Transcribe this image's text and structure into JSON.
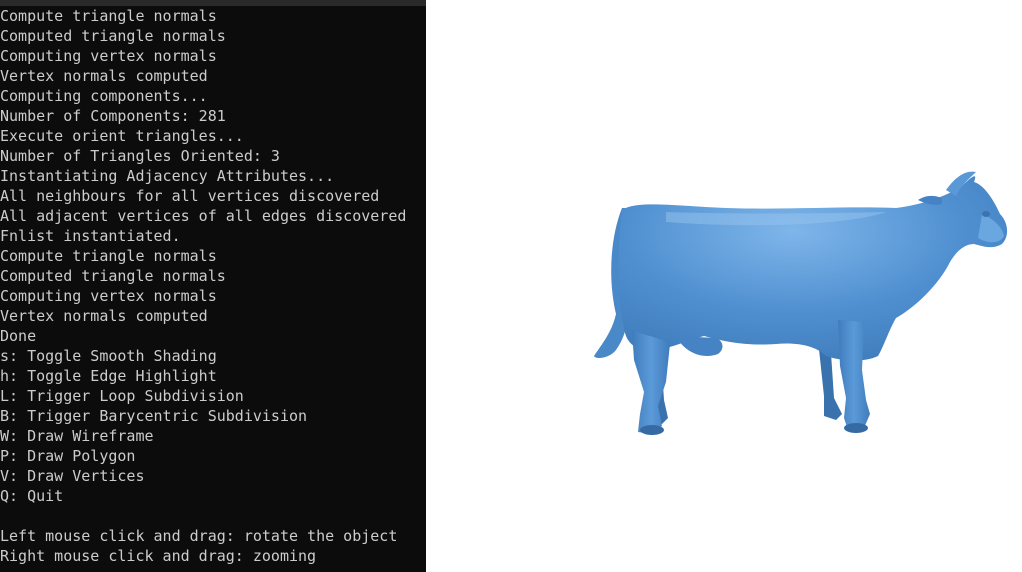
{
  "console": {
    "lines": [
      "Compute triangle normals",
      "Computed triangle normals",
      "Computing vertex normals",
      "Vertex normals computed",
      "Computing components...",
      "Number of Components: 281",
      "Execute orient triangles...",
      "Number of Triangles Oriented: 3",
      "Instantiating Adjacency Attributes...",
      "All neighbours for all vertices discovered",
      "All adjacent vertices of all edges discovered",
      "Fnlist instantiated.",
      "Compute triangle normals",
      "Computed triangle normals",
      "Computing vertex normals",
      "Vertex normals computed",
      "Done",
      "s: Toggle Smooth Shading",
      "h: Toggle Edge Highlight",
      "L: Trigger Loop Subdivision",
      "B: Trigger Barycentric Subdivision",
      "W: Draw Wireframe",
      "P: Draw Polygon",
      "V: Draw Vertices",
      "Q: Quit",
      "",
      "Left mouse click and drag: rotate the object",
      "Right mouse click and drag: zooming"
    ]
  },
  "viewport": {
    "model_icon": "cow-model-icon",
    "model_color": "#4f8fd0",
    "background_color": "#ffffff"
  }
}
